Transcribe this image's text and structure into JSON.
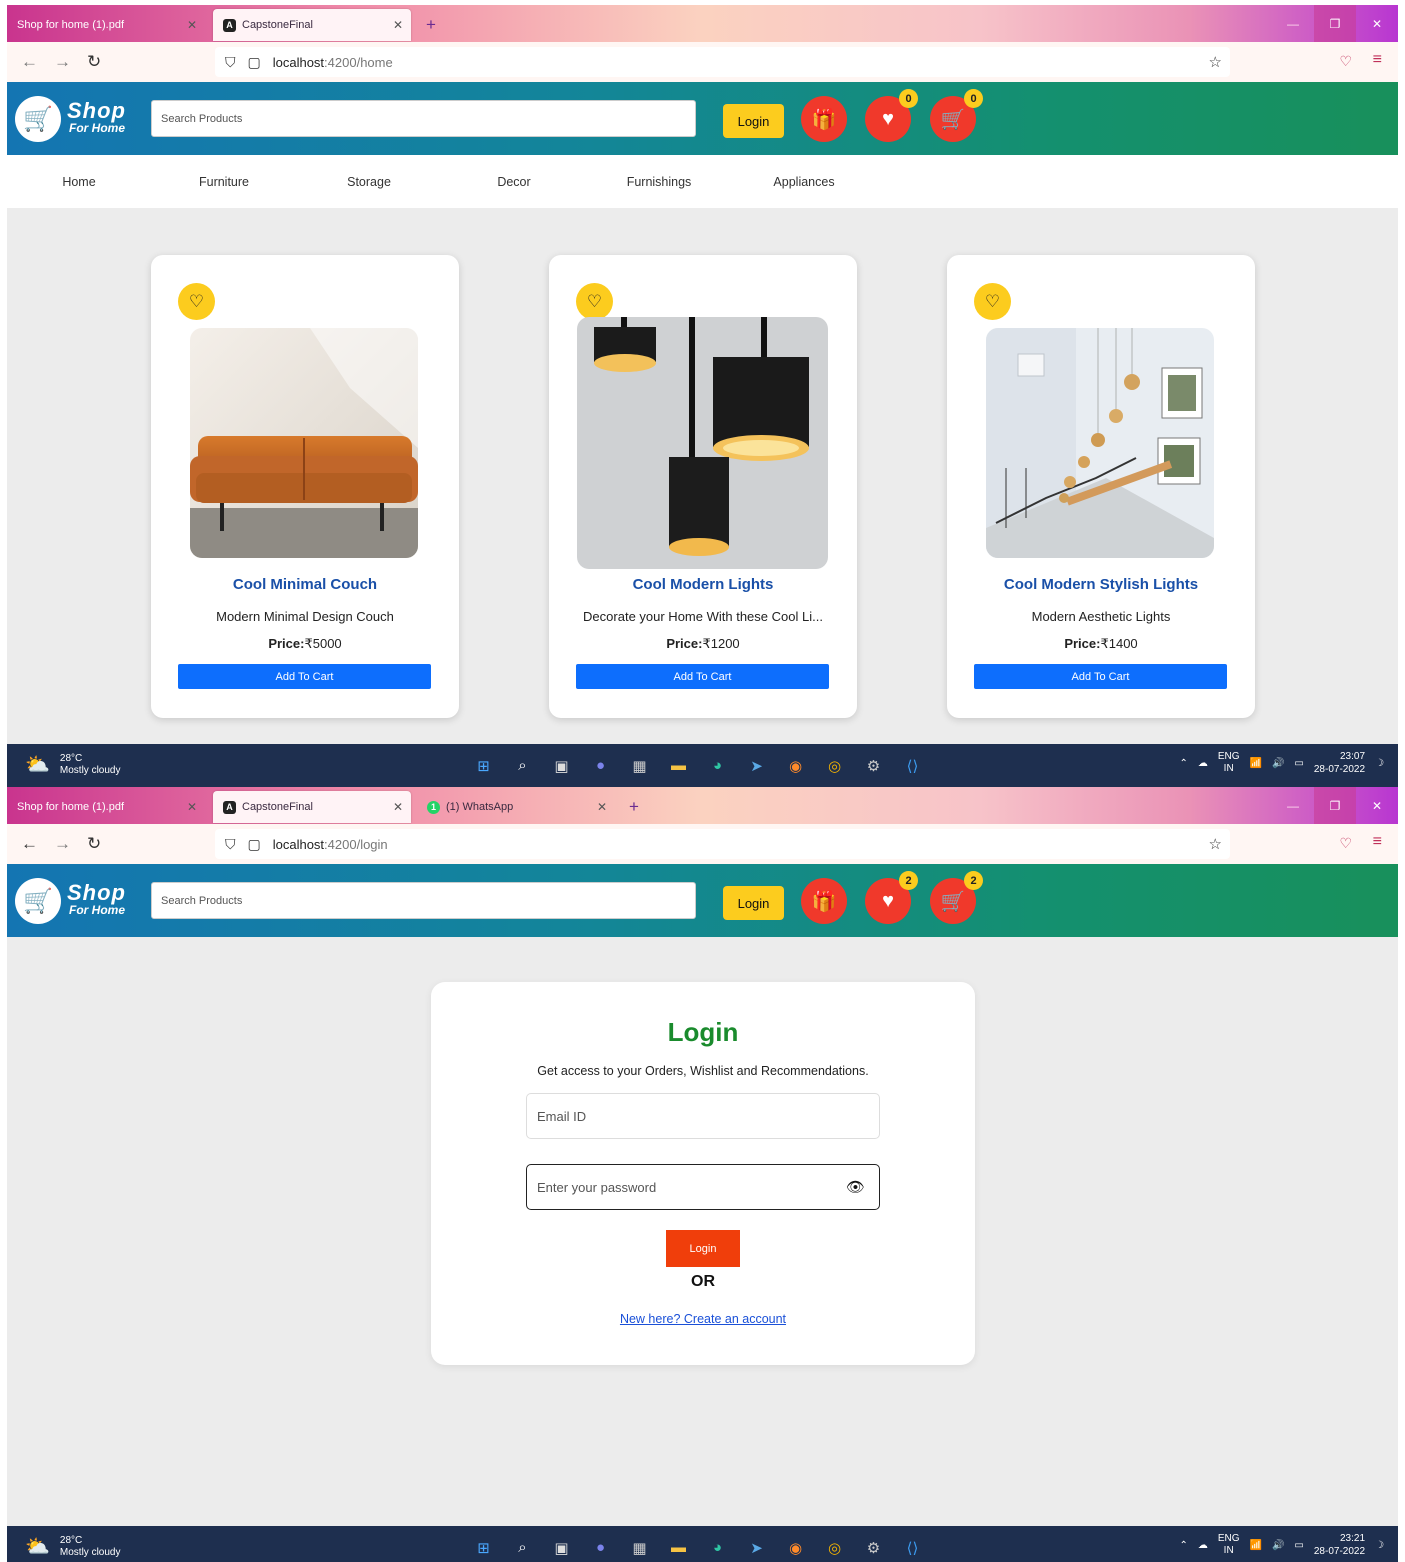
{
  "screens": [
    {
      "tabs": [
        {
          "title": "Shop for home (1).pdf"
        },
        {
          "title": "CapstoneFinal"
        }
      ],
      "url": {
        "host": "localhost",
        "path": ":4200/home"
      },
      "header": {
        "logo_line1": "Shop",
        "logo_line2": "For Home",
        "search_placeholder": "Search Products",
        "login_label": "Login",
        "wishlist_count": "0",
        "cart_count": "0"
      },
      "categories": [
        "Home",
        "Furniture",
        "Storage",
        "Decor",
        "Furnishings",
        "Appliances"
      ],
      "products": [
        {
          "title": "Cool Minimal Couch",
          "desc": "Modern Minimal Design Couch",
          "price_label": "Price:",
          "price": "₹5000",
          "button": "Add To Cart"
        },
        {
          "title": "Cool Modern Lights",
          "desc": "Decorate your Home With these Cool Li...",
          "price_label": "Price:",
          "price": "₹1200",
          "button": "Add To Cart"
        },
        {
          "title": "Cool Modern Stylish Lights",
          "desc": "Modern Aesthetic Lights",
          "price_label": "Price:",
          "price": "₹1400",
          "button": "Add To Cart"
        }
      ],
      "taskbar": {
        "temp": "28°C",
        "weather": "Mostly cloudy",
        "lang1": "ENG",
        "lang2": "IN",
        "time": "23:07",
        "date": "28-07-2022"
      }
    },
    {
      "tabs": [
        {
          "title": "Shop for home (1).pdf"
        },
        {
          "title": "CapstoneFinal"
        },
        {
          "title": "(1) WhatsApp"
        }
      ],
      "url": {
        "host": "localhost",
        "path": ":4200/login"
      },
      "header": {
        "logo_line1": "Shop",
        "logo_line2": "For Home",
        "search_placeholder": "Search Products",
        "login_label": "Login",
        "wishlist_count": "2",
        "cart_count": "2"
      },
      "login": {
        "title": "Login",
        "subtitle": "Get access to your Orders, Wishlist and Recommendations.",
        "email_placeholder": "Email ID",
        "password_placeholder": "Enter your password",
        "button": "Login",
        "or": "OR",
        "signup_link": "New here? Create an account"
      },
      "taskbar": {
        "temp": "28°C",
        "weather": "Mostly cloudy",
        "lang1": "ENG",
        "lang2": "IN",
        "time": "23:21",
        "date": "28-07-2022"
      }
    }
  ],
  "colors": {
    "header_start": "#1475b2",
    "header_end": "#18905b",
    "accent_yellow": "#fccc1e",
    "accent_red": "#f0392b",
    "primary_blue": "#0d6efd",
    "login_orange": "#f03e0b",
    "login_title_green": "#1a8b2d"
  }
}
